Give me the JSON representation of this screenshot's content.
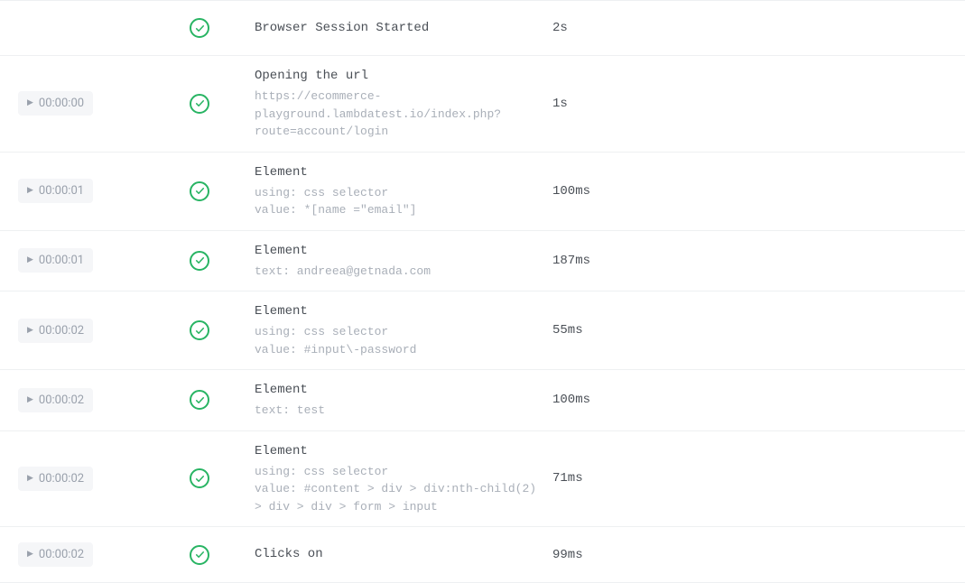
{
  "steps": [
    {
      "timestamp": null,
      "status": "pass",
      "title": "Browser Session Started",
      "meta": null,
      "duration": "2s"
    },
    {
      "timestamp": "00:00:00",
      "status": "pass",
      "title": "Opening the url",
      "meta": "https://ecommerce-playground.lambdatest.io/index.php?route=account/login",
      "duration": "1s"
    },
    {
      "timestamp": "00:00:01",
      "status": "pass",
      "title": "Element",
      "meta": "using: css selector\nvalue: *[name =\"email\"]",
      "duration": "100ms"
    },
    {
      "timestamp": "00:00:01",
      "status": "pass",
      "title": "Element",
      "meta": "text: andreea@getnada.com",
      "duration": "187ms"
    },
    {
      "timestamp": "00:00:02",
      "status": "pass",
      "title": "Element",
      "meta": "using: css selector\nvalue: #input\\-password",
      "duration": "55ms"
    },
    {
      "timestamp": "00:00:02",
      "status": "pass",
      "title": "Element",
      "meta": "text: test",
      "duration": "100ms"
    },
    {
      "timestamp": "00:00:02",
      "status": "pass",
      "title": "Element",
      "meta": "using: css selector\nvalue: #content > div > div:nth-child(2) > div > div > form > input",
      "duration": "71ms"
    },
    {
      "timestamp": "00:00:02",
      "status": "pass",
      "title": "Clicks on",
      "meta": null,
      "duration": "99ms"
    }
  ]
}
